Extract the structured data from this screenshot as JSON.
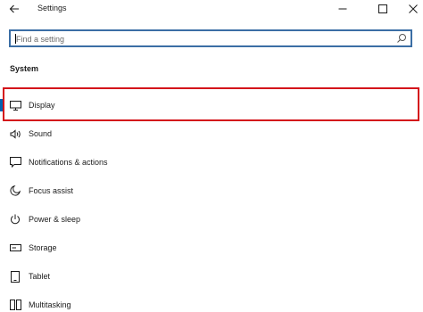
{
  "window": {
    "title": "Settings"
  },
  "search": {
    "placeholder": "Find a setting"
  },
  "section": {
    "title": "System"
  },
  "nav": {
    "selected": "Display",
    "items": [
      {
        "label": "Display",
        "icon": "monitor-icon"
      },
      {
        "label": "Sound",
        "icon": "speaker-icon"
      },
      {
        "label": "Notifications & actions",
        "icon": "notification-icon"
      },
      {
        "label": "Focus assist",
        "icon": "moon-icon"
      },
      {
        "label": "Power & sleep",
        "icon": "power-icon"
      },
      {
        "label": "Storage",
        "icon": "storage-icon"
      },
      {
        "label": "Tablet",
        "icon": "tablet-icon"
      },
      {
        "label": "Multitasking",
        "icon": "multitasking-icon"
      }
    ]
  },
  "colors": {
    "accent": "#0063b1",
    "highlight": "#d4141b",
    "search_border": "#3b6ea5"
  }
}
